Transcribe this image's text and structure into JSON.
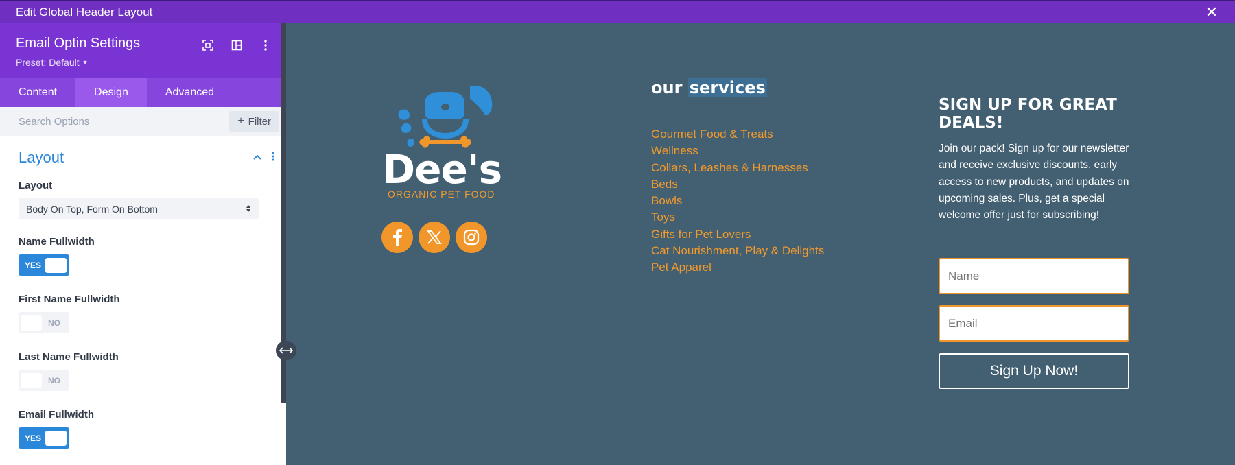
{
  "topbar": {
    "title": "Edit Global Header Layout",
    "close_glyph": "✕"
  },
  "panel": {
    "title": "Email Optin Settings",
    "preset": "Preset: Default",
    "tabs": [
      {
        "label": "Content"
      },
      {
        "label": "Design"
      },
      {
        "label": "Advanced"
      }
    ],
    "search_placeholder": "Search Options",
    "filter_label": "Filter",
    "section_title": "Layout",
    "layout_label": "Layout",
    "layout_value": "Body On Top, Form On Bottom",
    "toggles": [
      {
        "label": "Name Fullwidth",
        "state": "YES"
      },
      {
        "label": "First Name Fullwidth",
        "state": "NO"
      },
      {
        "label": "Last Name Fullwidth",
        "state": "NO"
      },
      {
        "label": "Email Fullwidth",
        "state": "YES"
      }
    ]
  },
  "preview": {
    "brand_name": "Dee's",
    "brand_tagline": "ORGANIC PET FOOD",
    "services_title_a": "our ",
    "services_title_b": "services",
    "services": [
      "Gourmet Food & Treats",
      "Wellness",
      "Collars, Leashes & Harnesses",
      "Beds",
      "Bowls",
      "Toys",
      "Gifts for Pet Lovers",
      "Cat Nourishment, Play & Delights",
      "Pet Apparel"
    ],
    "signup_title": "SIGN UP FOR GREAT DEALS!",
    "signup_body": "Join our pack! Sign up for our newsletter and receive exclusive discounts, early access to new products, and updates on upcoming sales. Plus, get a special welcome offer just for subscribing!",
    "name_placeholder": "Name",
    "email_placeholder": "Email",
    "signup_button": "Sign Up Now!"
  },
  "colors": {
    "topbar": "#6f2fc0",
    "panel_header": "#7b34d4",
    "accent_blue": "#2b87da",
    "preview_bg": "#435f72",
    "brand_orange": "#f0962a"
  }
}
